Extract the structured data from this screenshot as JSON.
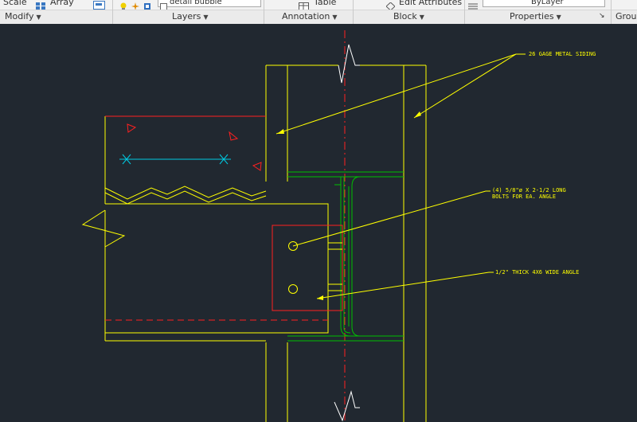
{
  "ribbon": {
    "top": {
      "scale_label": "Scale",
      "array_label": "Array",
      "layer_combo": "detail bubble",
      "table_label": "Table",
      "edit_attributes_label": "Edit Attributes",
      "bylayer_combo": "ByLayer"
    },
    "panels": {
      "modify": "Modify",
      "layers": "Layers",
      "annotation": "Annotation",
      "block": "Block",
      "properties": "Properties",
      "groups": "Group"
    }
  },
  "drawing": {
    "notes": {
      "siding": "26 GAGE METAL SIDING",
      "bolts_line1": "(4) 5/8\"ø X 2-1/2 LONG",
      "bolts_line2": "BOLTS FOR EA. ANGLE",
      "angle": "1/2\" THICK 4X6 WIDE ANGLE"
    },
    "colors": {
      "background": "#212830",
      "yellow": "#ffff00",
      "red": "#ff0000",
      "green": "#00c000",
      "cyan": "#00c8e0",
      "white": "#ffffff"
    }
  }
}
